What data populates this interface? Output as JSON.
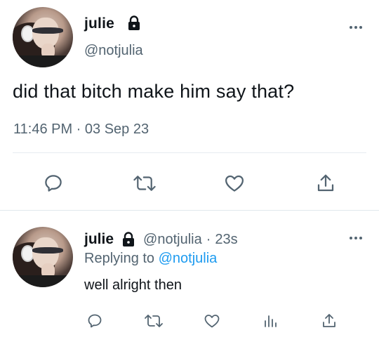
{
  "main_tweet": {
    "display_name": "julie",
    "handle": "@notjulia",
    "text": "did that bitch make him say that?",
    "timestamp": "11:46 PM · 03 Sep 23",
    "icons": [
      "lock-icon",
      "more-icon",
      "reply-icon",
      "retweet-icon",
      "like-icon",
      "share-icon"
    ]
  },
  "reply_tweet": {
    "display_name": "julie",
    "handle": "@notjulia",
    "separator": "·",
    "age": "23s",
    "replying_prefix": "Replying to",
    "replying_handle": "@notjulia",
    "text": "well alright then",
    "icons": [
      "lock-icon",
      "more-icon",
      "reply-icon",
      "retweet-icon",
      "like-icon",
      "views-icon",
      "share-icon"
    ]
  },
  "colors": {
    "text": "#0f1419",
    "secondary": "#536471",
    "link": "#1d9bf0",
    "divider": "#e6ecf0"
  }
}
